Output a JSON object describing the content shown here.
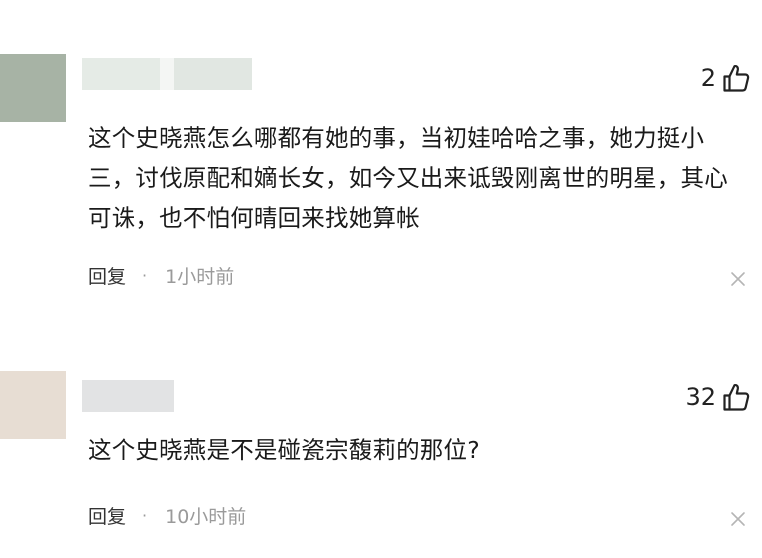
{
  "comments": [
    {
      "likes": "2",
      "text": "这个史晓燕怎么哪都有她的事，当初娃哈哈之事，她力挺小三，讨伐原配和嫡长女，如今又出来诋毁刚离世的明星，其心可诛，也不怕何晴回来找她算帐",
      "reply_label": "回复",
      "separator": "·",
      "time": "1小时前"
    },
    {
      "likes": "32",
      "text": "这个史晓燕是不是碰瓷宗馥莉的那位?",
      "reply_label": "回复",
      "separator": "·",
      "time": "10小时前"
    }
  ],
  "icons": {
    "like": "thumbs-up-icon",
    "close": "close-icon"
  },
  "colors": {
    "text": "#1a1a1a",
    "muted": "#9a9a9a",
    "avatar_1": "#a7b3a5",
    "avatar_2": "#e7ddd3"
  }
}
